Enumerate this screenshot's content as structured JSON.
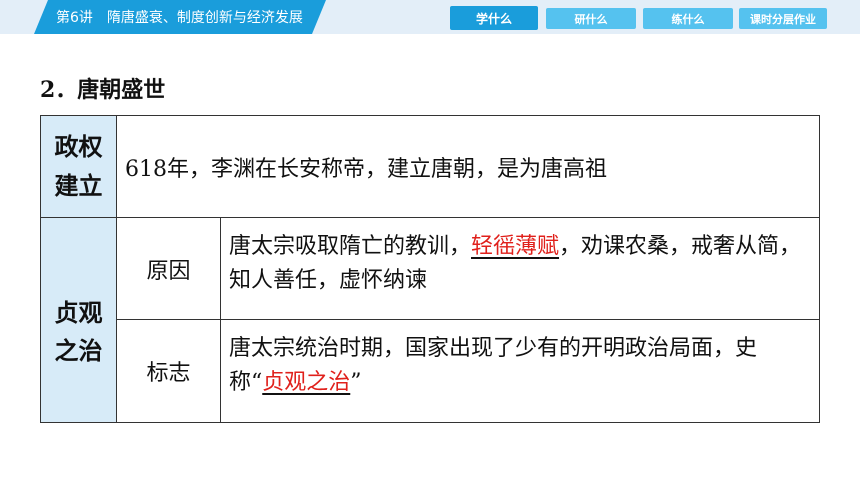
{
  "header": {
    "lesson_number": "第6讲",
    "lesson_title": "隋唐盛衰、制度创新与经济发展",
    "nav": [
      {
        "label": "学什么",
        "active": true
      },
      {
        "label": "研什么",
        "active": false
      },
      {
        "label": "练什么",
        "active": false
      },
      {
        "label": "课时分层作业",
        "active": false
      }
    ]
  },
  "section": {
    "title": "2．唐朝盛世"
  },
  "table": {
    "row1": {
      "category_line1": "政权",
      "category_line2": "建立",
      "content": "618年，李渊在长安称帝，建立唐朝，是为唐高祖"
    },
    "row2": {
      "category_line1": "贞观",
      "category_line2": "之治",
      "reason": {
        "label": "原因",
        "text_before": "唐太宗吸取隋亡的教训，",
        "highlight": "轻徭薄赋",
        "text_after": "，劝课农桑，戒奢从简，知人善任，虚怀纳谏"
      },
      "sign": {
        "label": "标志",
        "text_before": "唐太宗统治时期，国家出现了少有的开明政治局面，史称“",
        "highlight": "贞观之治",
        "text_after": "”"
      }
    }
  },
  "colors": {
    "accent": "#1a9ddb",
    "nav_inactive": "#55c2ef",
    "category_bg": "#d7ebf8",
    "highlight_text": "#e0201b"
  }
}
